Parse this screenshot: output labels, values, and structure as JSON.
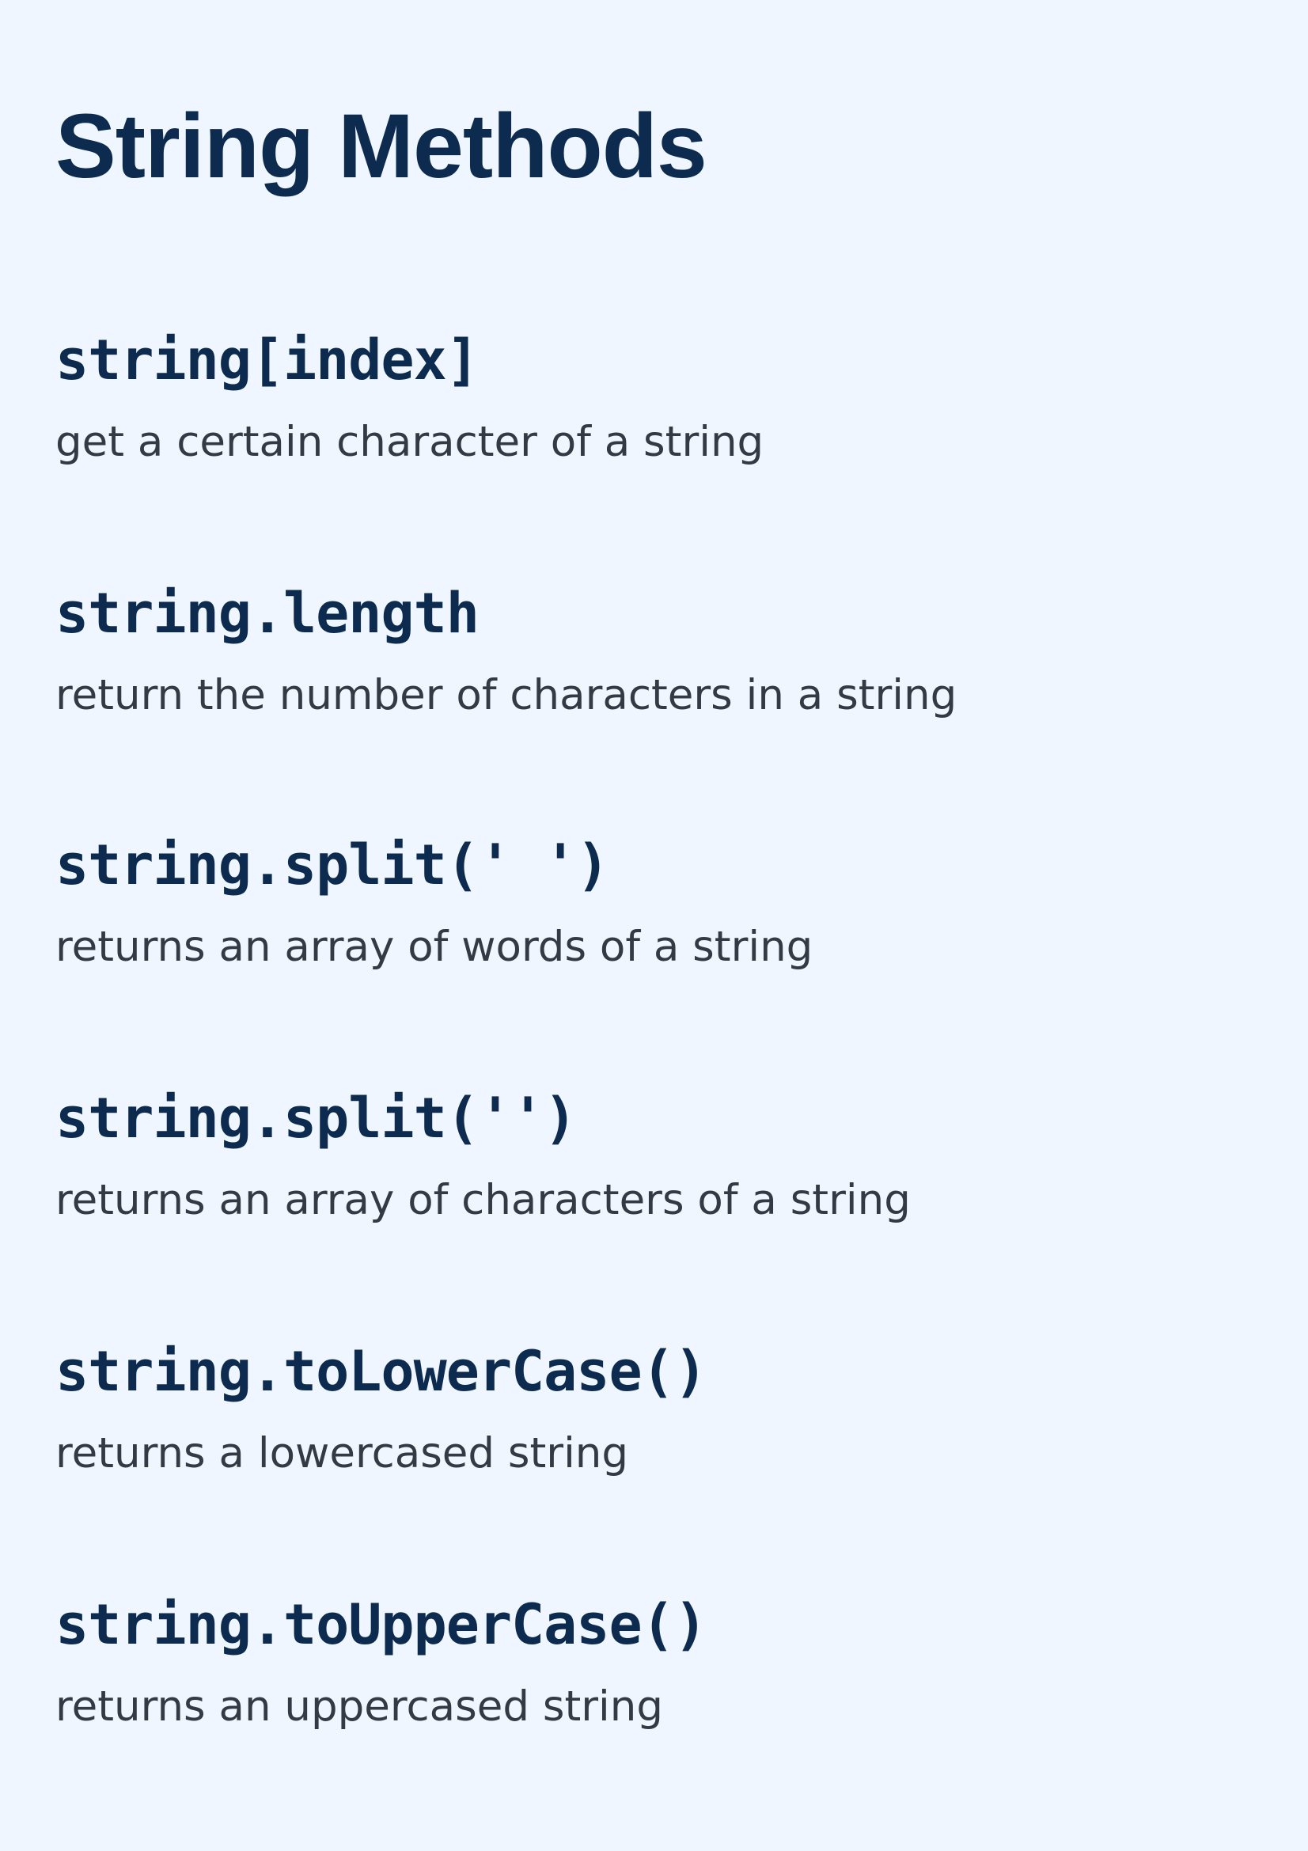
{
  "title": "String Methods",
  "methods": [
    {
      "code": "string[index]",
      "description": "get a certain character of a string"
    },
    {
      "code": "string.length",
      "description": "return the number of characters in a string"
    },
    {
      "code": "string.split(' ')",
      "description": "returns an array of words of a string"
    },
    {
      "code": "string.split('')",
      "description": "returns an array of characters of a string"
    },
    {
      "code": "string.toLowerCase()",
      "description": "returns a lowercased string"
    },
    {
      "code": "string.toUpperCase()",
      "description": "returns an uppercased string"
    }
  ],
  "colors": {
    "background": "#eff6ff",
    "heading": "#0d2b4f",
    "body_text": "#333a44"
  }
}
